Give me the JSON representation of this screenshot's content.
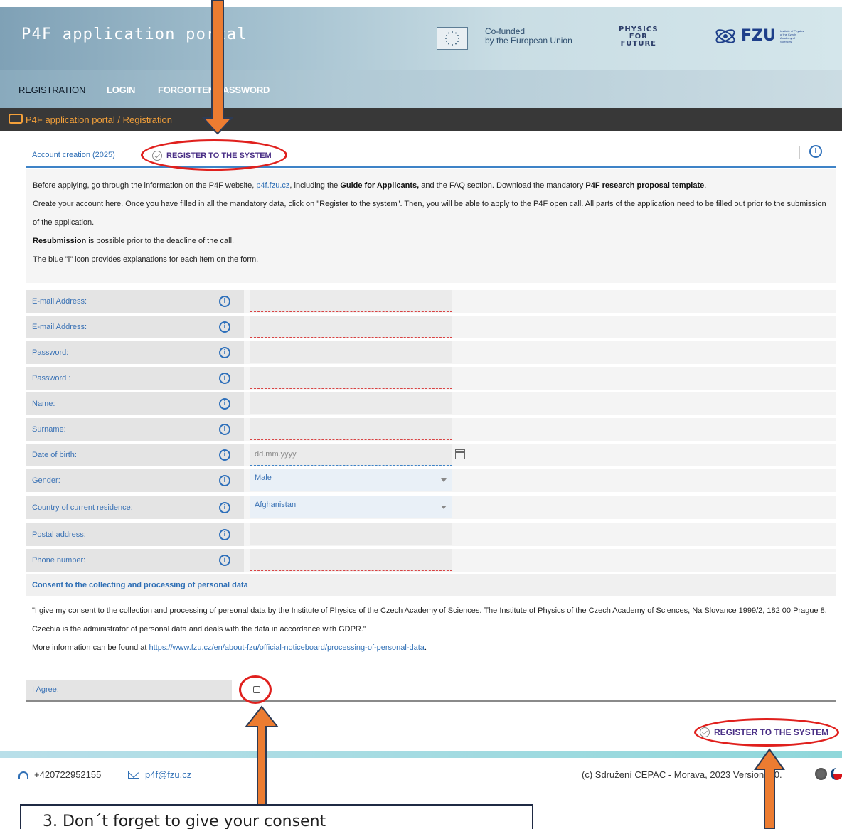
{
  "header": {
    "title": "P4F application portal",
    "eu_text": [
      "Co-funded",
      "by the European Union"
    ],
    "p4f_logo": [
      "PHYSICS",
      "FOR",
      "FUTURE"
    ],
    "fzu_logo": "FZU",
    "fzu_sub": "Institute of Physics of the Czech Academy of Sciences"
  },
  "nav": {
    "items": [
      "REGISTRATION",
      "LOGIN",
      "FORGOTTEN PASSWORD"
    ]
  },
  "breadcrumb": "P4F application portal / Registration",
  "tabs": {
    "account": "Account creation (2025)",
    "register": "REGISTER TO THE SYSTEM"
  },
  "intro": {
    "p1a": "Before applying, go through the information on the P4F website, ",
    "p1link": "p4f.fzu.cz",
    "p1b": ", including the ",
    "p1bold": "Guide for Applicants,",
    "p1c": " and the FAQ section. Download the mandatory ",
    "p1bold2": "P4F research proposal template",
    "p1d": ".",
    "p2": "Create your account here. Once you have filled in all the mandatory data, click on \"Register to the system\". Then, you will be able to apply to the P4F open call. All parts of the application need to be filled out prior to the submission of the application.",
    "p3bold": "Resubmission",
    "p3": " is possible prior to the deadline of the call.",
    "p4": "The blue \"i\" icon provides explanations for each item on the form."
  },
  "form": {
    "email1": "E-mail Address:",
    "email2": "E-mail Address:",
    "password1": "Password:",
    "password2": "Password :",
    "name": "Name:",
    "surname": "Surname:",
    "dob": "Date of birth:",
    "dob_placeholder": "dd.mm.yyyy",
    "gender": "Gender:",
    "gender_value": "Male",
    "country": "Country of current residence:",
    "country_value": "Afghanistan",
    "postal": "Postal address:",
    "phone": "Phone number:"
  },
  "consent": {
    "title": "Consent to the collecting and processing of personal data",
    "text": "\"I give my consent to the collection and processing of personal data by the Institute of Physics of the Czech Academy of Sciences. The Institute of Physics of the Czech Academy of Sciences, Na Slovance 1999/2, 182 00 Prague 8, Czechia is the administrator of personal data and deals with the data in accordance with GDPR.\"",
    "more": "More information can be found at ",
    "link": "https://www.fzu.cz/en/about-fzu/official-noticeboard/processing-of-personal-data",
    "link_end": ".",
    "agree": "I Agree:"
  },
  "register_bottom": "REGISTER TO THE SYSTEM",
  "footer": {
    "phone": "+420722952155",
    "email": "p4f@fzu.cz",
    "copy": "(c) Sdružení CEPAC - Morava, 2023 Version 2.0."
  },
  "callout": "3.   Don´t forget to give your consent",
  "colors": {
    "annotation_arrow": "#ec7c31",
    "annotation_ellipse": "#e0201d",
    "accent_blue": "#2f6fb5",
    "purple": "#4a2f86"
  }
}
